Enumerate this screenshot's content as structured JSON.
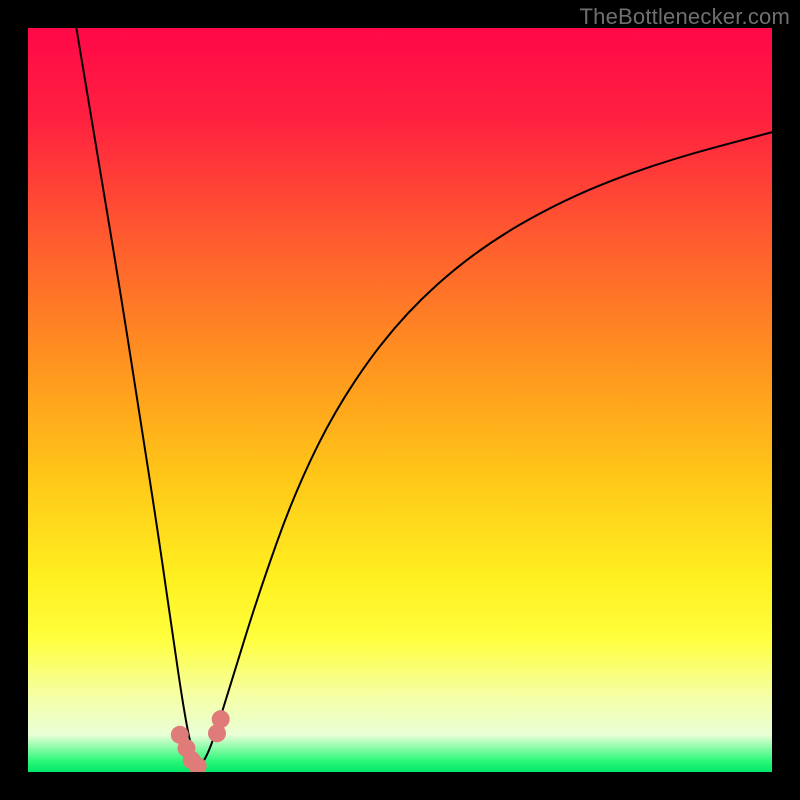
{
  "watermark": "TheBottlenecker.com",
  "gradient": {
    "stops": [
      {
        "offset": 0.0,
        "color": "#ff0848"
      },
      {
        "offset": 0.12,
        "color": "#ff2040"
      },
      {
        "offset": 0.28,
        "color": "#ff5a2f"
      },
      {
        "offset": 0.44,
        "color": "#ff9020"
      },
      {
        "offset": 0.6,
        "color": "#ffc618"
      },
      {
        "offset": 0.74,
        "color": "#fff020"
      },
      {
        "offset": 0.82,
        "color": "#ffff3c"
      },
      {
        "offset": 0.9,
        "color": "#f5ffa8"
      },
      {
        "offset": 0.95,
        "color": "#e9ffd6"
      },
      {
        "offset": 0.985,
        "color": "#2cf87a"
      },
      {
        "offset": 1.0,
        "color": "#00e868"
      }
    ]
  },
  "chart_data": {
    "type": "line",
    "title": "",
    "xlabel": "",
    "ylabel": "",
    "xlim": [
      0,
      100
    ],
    "ylim": [
      0,
      100
    ],
    "x_optimum": 23,
    "series": [
      {
        "name": "left-branch",
        "points": [
          {
            "x": 6.5,
            "y": 100
          },
          {
            "x": 9.5,
            "y": 82
          },
          {
            "x": 12.5,
            "y": 64
          },
          {
            "x": 15.0,
            "y": 48
          },
          {
            "x": 17.5,
            "y": 32
          },
          {
            "x": 19.5,
            "y": 18
          },
          {
            "x": 21.0,
            "y": 8
          },
          {
            "x": 22.0,
            "y": 3
          },
          {
            "x": 23.0,
            "y": 0.5
          }
        ]
      },
      {
        "name": "right-branch",
        "points": [
          {
            "x": 23.0,
            "y": 0.5
          },
          {
            "x": 24.5,
            "y": 3
          },
          {
            "x": 27.0,
            "y": 11
          },
          {
            "x": 31.0,
            "y": 24
          },
          {
            "x": 36.0,
            "y": 38
          },
          {
            "x": 42.0,
            "y": 50
          },
          {
            "x": 50.0,
            "y": 61
          },
          {
            "x": 60.0,
            "y": 70
          },
          {
            "x": 72.0,
            "y": 77
          },
          {
            "x": 85.0,
            "y": 82
          },
          {
            "x": 100.0,
            "y": 86
          }
        ]
      }
    ],
    "markers": [
      {
        "x": 20.4,
        "y": 5.0
      },
      {
        "x": 21.3,
        "y": 3.2
      },
      {
        "x": 22.0,
        "y": 1.6
      },
      {
        "x": 22.8,
        "y": 0.8
      },
      {
        "x": 25.4,
        "y": 5.2
      },
      {
        "x": 25.9,
        "y": 7.1
      }
    ],
    "marker_color": "#df7b79",
    "line_color": "#000000"
  }
}
